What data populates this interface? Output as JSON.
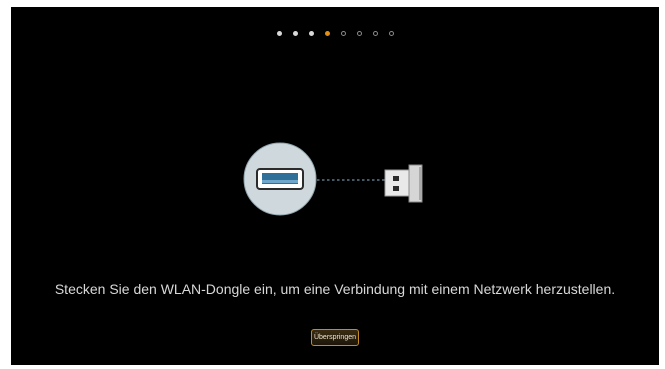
{
  "progress": {
    "total_steps": 8,
    "current_step": 4
  },
  "illustration": {
    "port_icon": "usb-port-icon",
    "dongle_icon": "usb-wifi-dongle-icon",
    "colors": {
      "port_circle": "#cfd8dc",
      "port_body": "#2f6f98",
      "link_line": "#6f8fa3",
      "dongle_body": "#e6e6e6"
    }
  },
  "message": {
    "text": "Stecken Sie den WLAN-Dongle ein, um eine Verbindung mit einem Netzwerk herzustellen."
  },
  "skip_button": {
    "label": "Überspringen"
  },
  "colors": {
    "background": "#000000",
    "accent": "#e38e14",
    "text": "#d8d8d8"
  }
}
